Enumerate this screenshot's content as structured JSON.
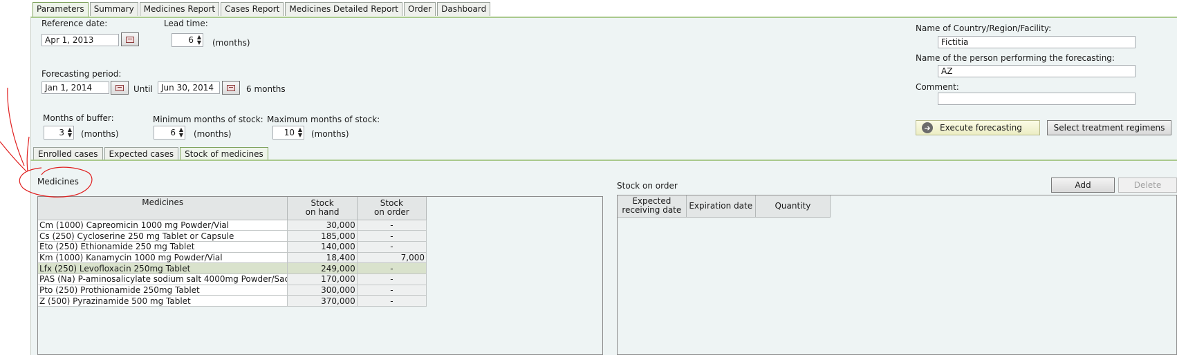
{
  "top_tabs": [
    "Parameters",
    "Summary",
    "Medicines Report",
    "Cases Report",
    "Medicines Detailed Report",
    "Order",
    "Dashboard"
  ],
  "params": {
    "reference_date_label": "Reference date:",
    "reference_date": "Apr 1, 2013",
    "lead_time_label": "Lead time:",
    "lead_time": "6",
    "months_unit": "(months)",
    "forecasting_period_label": "Forecasting period:",
    "period_start": "Jan 1, 2014",
    "until_label": "Until",
    "period_end": "Jun 30, 2014",
    "period_length": "6 months",
    "buffer_label": "Months of buffer:",
    "buffer": "3",
    "min_stock_label": "Minimum months of stock:",
    "min_stock": "6",
    "max_stock_label": "Maximum months of stock:",
    "max_stock": "10",
    "country_label": "Name of Country/Region/Facility:",
    "country": "Fictitia",
    "person_label": "Name of the person performing the forecasting:",
    "person": "AZ",
    "comment_label": "Comment:",
    "comment": "",
    "execute_label": "Execute forecasting",
    "regimens_label": "Select treatment regimens"
  },
  "sub_tabs": [
    "Enrolled cases",
    "Expected cases",
    "Stock of medicines"
  ],
  "medicines": {
    "section_label": "Medicines",
    "headers": {
      "name": "Medicines",
      "on_hand_1": "Stock",
      "on_hand_2": "on hand",
      "on_order_1": "Stock",
      "on_order_2": "on order"
    },
    "rows": [
      {
        "name": "Cm (1000)  Capreomicin  1000 mg  Powder/Vial",
        "on_hand": "30,000",
        "on_order": "-"
      },
      {
        "name": "Cs (250)  Cycloserine  250 mg  Tablet or Capsule",
        "on_hand": "185,000",
        "on_order": "-"
      },
      {
        "name": "Eto (250)  Ethionamide  250 mg  Tablet",
        "on_hand": "140,000",
        "on_order": "-"
      },
      {
        "name": "Km (1000)  Kanamycin  1000 mg  Powder/Vial",
        "on_hand": "18,400",
        "on_order": "7,000"
      },
      {
        "name": "Lfx (250)  Levofloxacin  250mg  Tablet",
        "on_hand": "249,000",
        "on_order": "-"
      },
      {
        "name": "PAS (Na)  P-aminosalicylate sodium salt  4000mg  Powder/Sac...",
        "on_hand": "170,000",
        "on_order": "-"
      },
      {
        "name": "Pto (250)  Prothionamide   250mg  Tablet",
        "on_hand": "300,000",
        "on_order": "-"
      },
      {
        "name": "Z (500)  Pyrazinamide  500 mg  Tablet",
        "on_hand": "370,000",
        "on_order": "-"
      }
    ],
    "selected_index": 4
  },
  "stock_on_order": {
    "section_label": "Stock on order",
    "add_label": "Add",
    "delete_label": "Delete",
    "headers": {
      "receiving_1": "Expected",
      "receiving_2": "receiving date",
      "expiration": "Expiration date",
      "quantity": "Quantity"
    }
  },
  "colors": {
    "annotation": "#e02020",
    "tab_accent": "#a9c98c",
    "selected_row": "#d9e2cc"
  }
}
